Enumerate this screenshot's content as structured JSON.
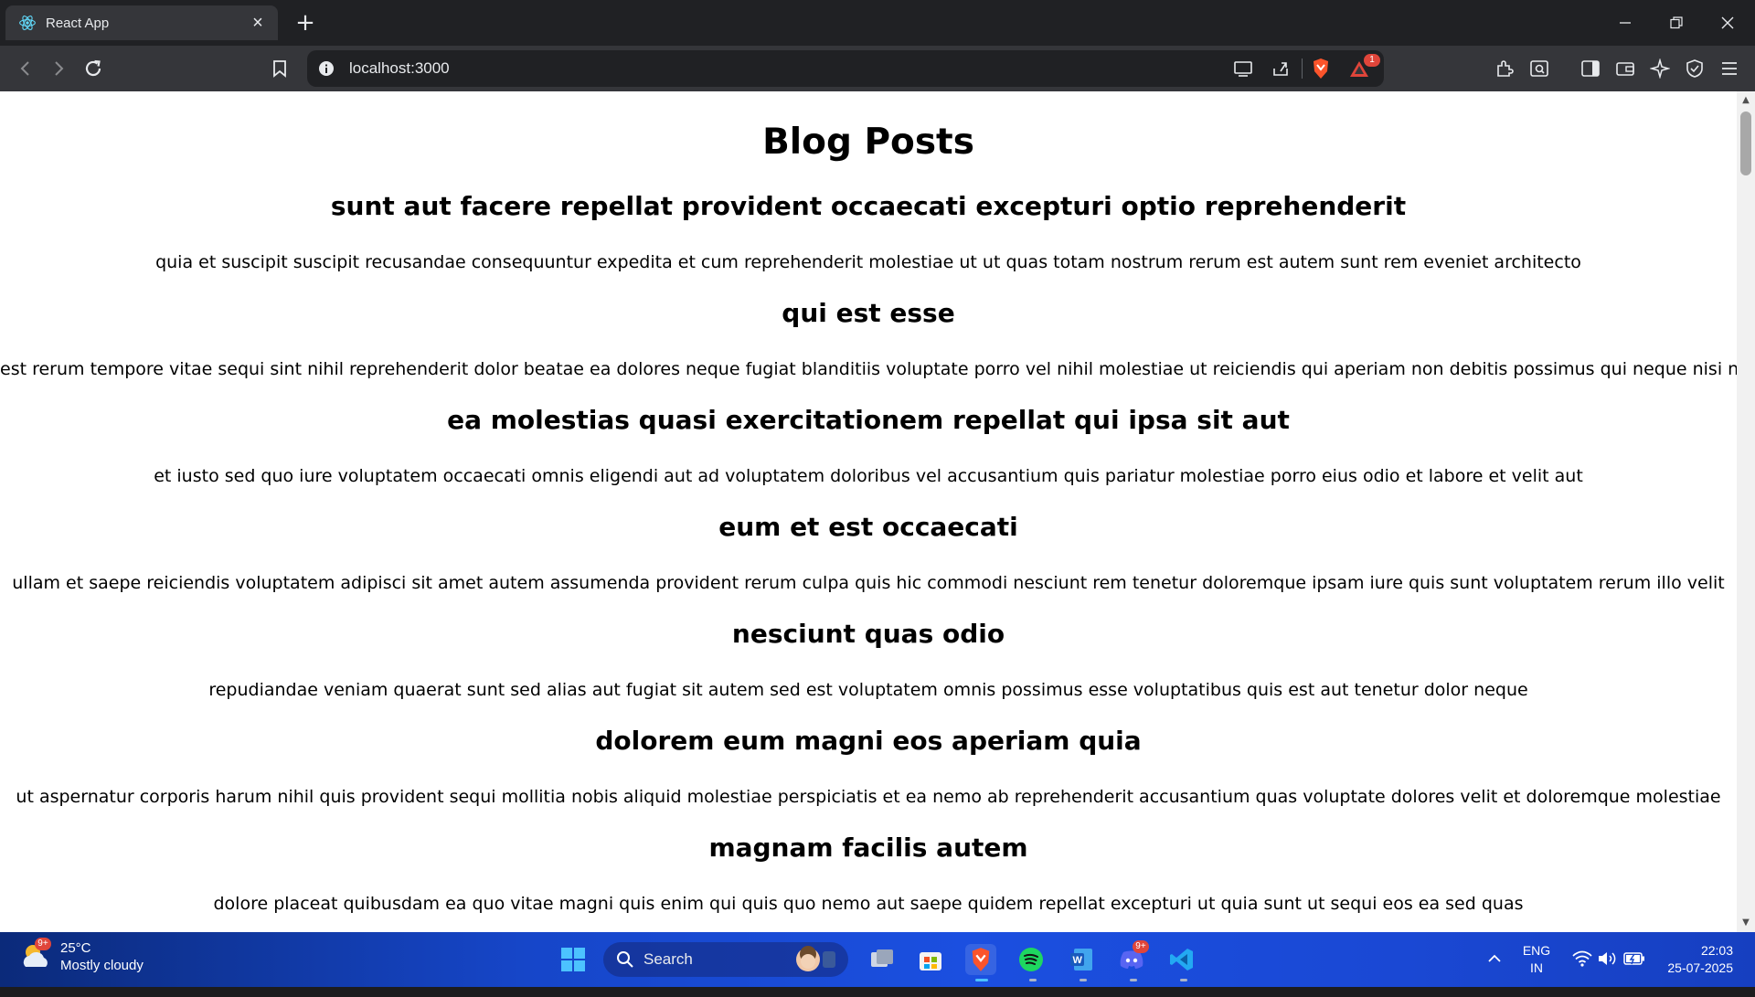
{
  "browser": {
    "tab_title": "React App",
    "url": "localhost:3000",
    "alerts_badge": "1"
  },
  "page": {
    "heading": "Blog Posts",
    "posts": [
      {
        "title": "sunt aut facere repellat provident occaecati excepturi optio reprehenderit",
        "body": "quia et suscipit suscipit recusandae consequuntur expedita et cum reprehenderit molestiae ut ut quas totam nostrum rerum est autem sunt rem eveniet architecto"
      },
      {
        "title": "qui est esse",
        "body": "est rerum tempore vitae sequi sint nihil reprehenderit dolor beatae ea dolores neque fugiat blanditiis voluptate porro vel nihil molestiae ut reiciendis qui aperiam non debitis possimus qui neque nisi nulla"
      },
      {
        "title": "ea molestias quasi exercitationem repellat qui ipsa sit aut",
        "body": "et iusto sed quo iure voluptatem occaecati omnis eligendi aut ad voluptatem doloribus vel accusantium quis pariatur molestiae porro eius odio et labore et velit aut"
      },
      {
        "title": "eum et est occaecati",
        "body": "ullam et saepe reiciendis voluptatem adipisci sit amet autem assumenda provident rerum culpa quis hic commodi nesciunt rem tenetur doloremque ipsam iure quis sunt voluptatem rerum illo velit"
      },
      {
        "title": "nesciunt quas odio",
        "body": "repudiandae veniam quaerat sunt sed alias aut fugiat sit autem sed est voluptatem omnis possimus esse voluptatibus quis est aut tenetur dolor neque"
      },
      {
        "title": "dolorem eum magni eos aperiam quia",
        "body": "ut aspernatur corporis harum nihil quis provident sequi mollitia nobis aliquid molestiae perspiciatis et ea nemo ab reprehenderit accusantium quas voluptate dolores velit et doloremque molestiae"
      },
      {
        "title": "magnam facilis autem",
        "body": "dolore placeat quibusdam ea quo vitae magni quis enim qui quis quo nemo aut saepe quidem repellat excepturi ut quia sunt ut sequi eos ea sed quas"
      }
    ]
  },
  "taskbar": {
    "weather_temp": "25°C",
    "weather_desc": "Mostly cloudy",
    "weather_badge": "9+",
    "search_label": "Search",
    "discord_badge": "9+",
    "lang_top": "ENG",
    "lang_bottom": "IN",
    "time": "22:03",
    "date": "25-07-2025"
  },
  "colors": {
    "tab_strip": "#202124",
    "toolbar": "#35363a",
    "page_bg": "#ffffff",
    "taskbar_accent": "#1b4fe0"
  }
}
